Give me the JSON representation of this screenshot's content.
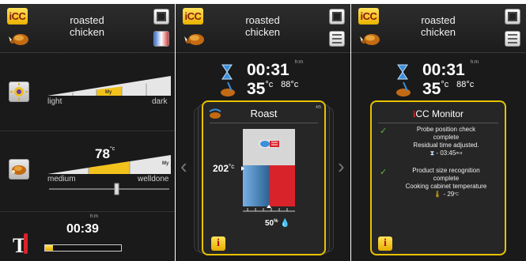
{
  "common": {
    "logo_text": "iCC",
    "title_line1": "roasted",
    "title_line2": "chicken"
  },
  "panel1": {
    "browning": {
      "left_label": "light",
      "right_label": "dark",
      "marker": "My"
    },
    "doneness": {
      "temperature": "78",
      "temp_unit": "°c",
      "left_label": "medium",
      "right_label": "welldone",
      "marker": "My"
    },
    "timer": {
      "value": "00:39",
      "unit": "h:m",
      "progress": 0.1
    }
  },
  "panel2": {
    "time": "00:31",
    "time_unit": "h:m",
    "temp": "35",
    "temp_unit": "°c",
    "temp_secondary": "88°c",
    "card": {
      "title": "Roast",
      "page": "4/5",
      "cabinet_temp": "202",
      "cabinet_unit": "°c",
      "humidity": "50",
      "humidity_unit": "%"
    }
  },
  "panel3": {
    "time": "00:31",
    "time_unit": "h:m",
    "temp": "35",
    "temp_unit": "°c",
    "temp_secondary": "88°c",
    "monitor": {
      "title": "CC Monitor",
      "item1_line1": "Probe position check",
      "item1_line2": "complete",
      "item1_line3": "Residual time adjusted.",
      "item1_time": "03:45",
      "item1_time_unit": "m:s",
      "item2_line1": "Product size recognition",
      "item2_line2": "complete",
      "item2_line3": "Cooking cabinet temperature",
      "item2_temp": "29",
      "item2_temp_unit": "°C"
    }
  },
  "colors": {
    "accent": "#e8c200",
    "hot": "#d9232a",
    "cold": "#3f8fd8",
    "bg": "#1a1a1a",
    "check": "#5bbd3a"
  }
}
